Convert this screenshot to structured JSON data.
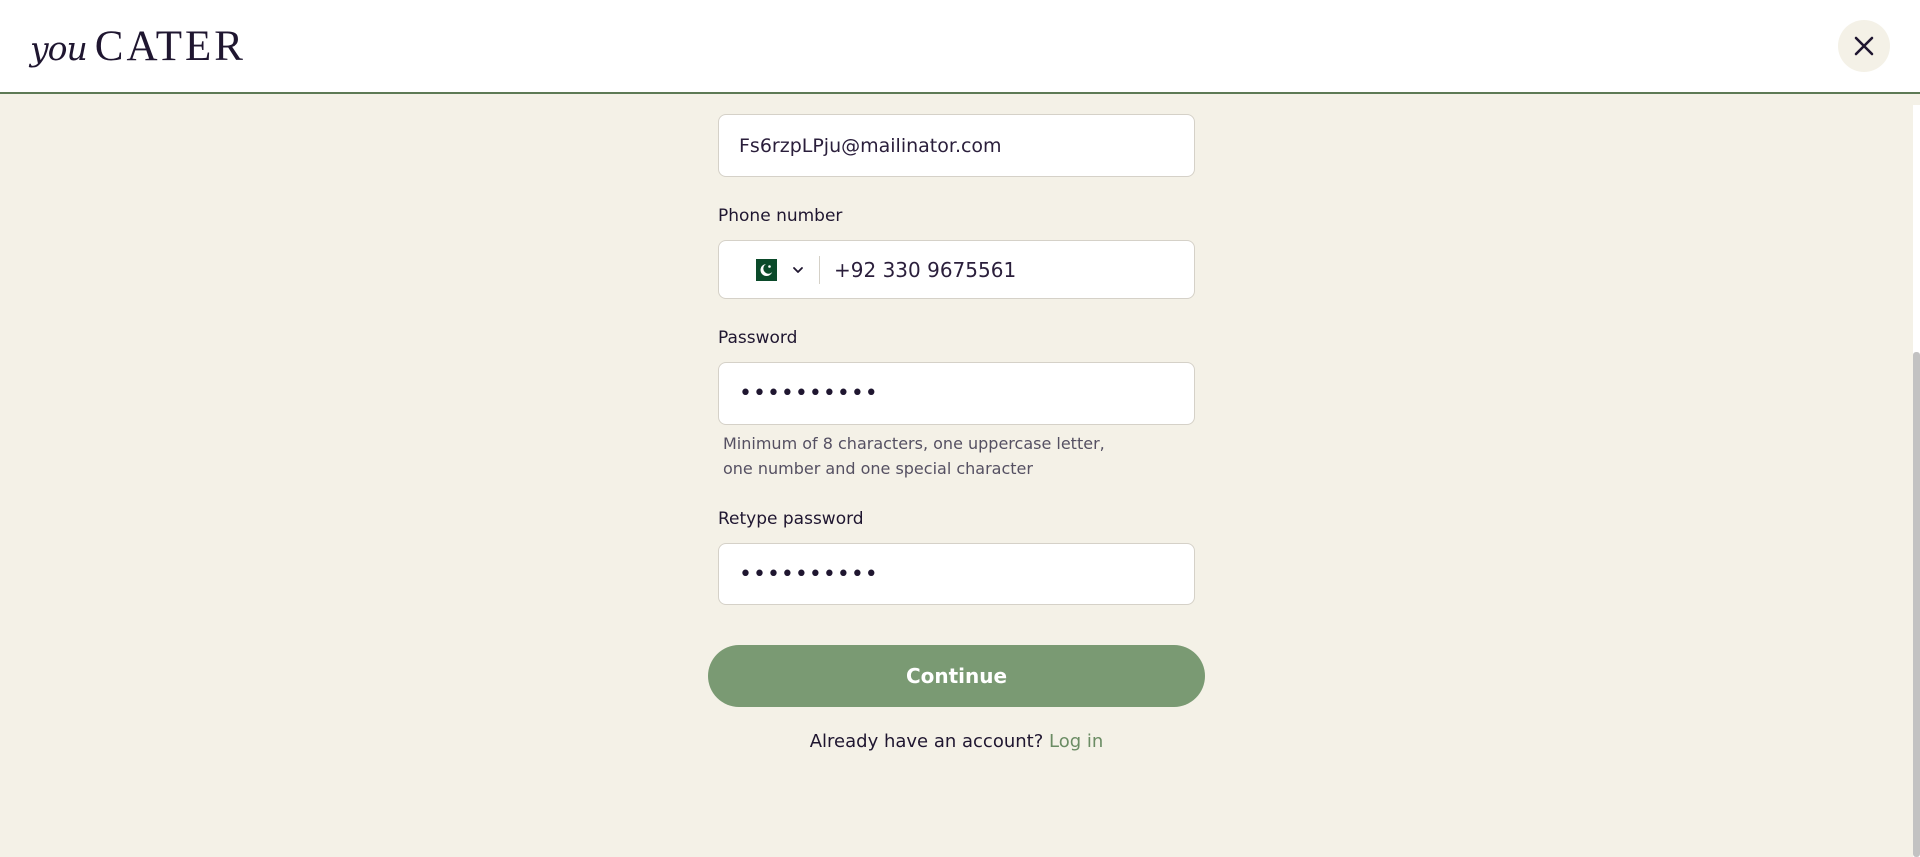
{
  "header": {
    "logo_you": "you",
    "logo_cater": "CATER"
  },
  "form": {
    "email_value": "Fs6rzpLPju@mailinator.com",
    "phone_label": "Phone number",
    "phone_country_icon": "pakistan-flag-icon",
    "phone_value": "+92 330 9675561",
    "password_label": "Password",
    "password_value": "••••••••••",
    "password_hint_line1": "Minimum of 8 characters, one uppercase letter,",
    "password_hint_line2": "one number and one special character",
    "retype_label": "Retype password",
    "retype_value": "••••••••••",
    "continue_label": "Continue",
    "login_prompt": "Already have an account?",
    "login_link": "Log in"
  },
  "colors": {
    "background": "#f4f1e7",
    "accent_green": "#7a9a73",
    "link_green": "#6b8c64",
    "text_dark": "#1f1630"
  }
}
